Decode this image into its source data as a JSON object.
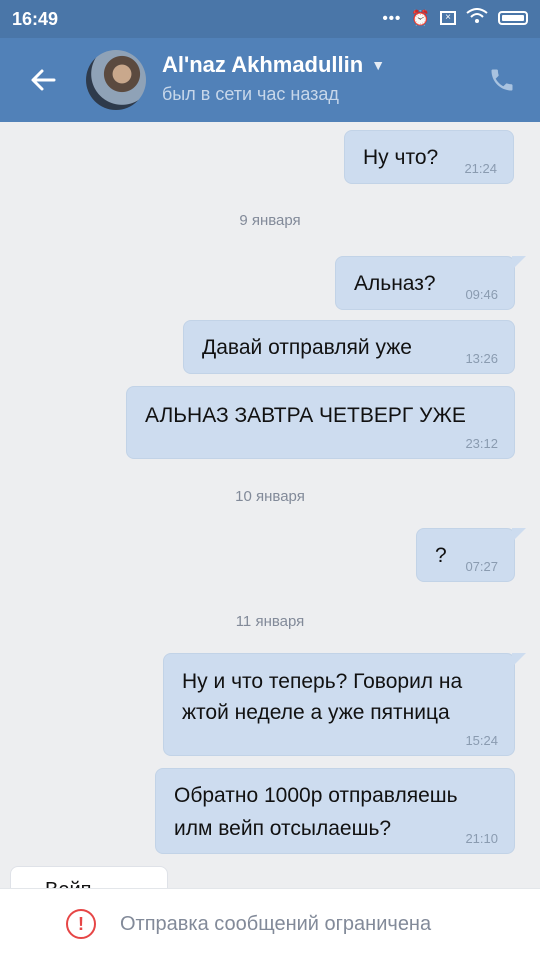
{
  "status_bar": {
    "time": "16:49"
  },
  "header": {
    "name": "Al'naz Akhmadullin",
    "presence": "был в сети час назад"
  },
  "messages": [
    {
      "text": "Ну что?",
      "time": "21:24"
    },
    {
      "text": "Альназ?",
      "time": "09:46"
    },
    {
      "text": "Давай отправляй уже",
      "time": "13:26"
    },
    {
      "text": "АЛЬНАЗ ЗАВТРА ЧЕТВЕРГ УЖЕ",
      "time": "23:12"
    },
    {
      "text": "?",
      "time": "07:27"
    },
    {
      "line1": "Ну и что теперь? Говорил на",
      "line2": "жтой неделе а уже пятница",
      "time": "15:24"
    },
    {
      "line1": "Обратно 1000р отправляешь",
      "line2": "илм вейп отсылаешь?",
      "time": "21:10"
    }
  ],
  "dates": {
    "d1": "9 января",
    "d2": "10 января",
    "d3": "11 января"
  },
  "incoming_partial": "Вейп",
  "footer": {
    "text": "Отправка сообщений ограничена"
  },
  "colors": {
    "header": "#5181b8",
    "bubble_out": "#cddcef",
    "warning": "#e64646"
  }
}
